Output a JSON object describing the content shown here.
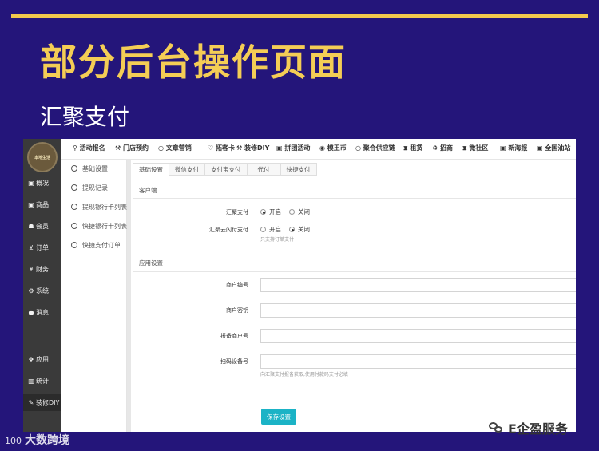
{
  "slide": {
    "title": "部分后台操作页面",
    "subtitle": "汇聚支付"
  },
  "logo_text": "本地生活",
  "left_nav": [
    {
      "icon": "window-icon",
      "glyph": "▣",
      "label": "概况"
    },
    {
      "icon": "box-icon",
      "glyph": "▣",
      "label": "商品"
    },
    {
      "icon": "users-icon",
      "glyph": "👥",
      "label": "会员"
    },
    {
      "icon": "cart-icon",
      "glyph": "🛒",
      "label": "订单"
    },
    {
      "icon": "yen-icon",
      "glyph": "¥",
      "label": "财务"
    },
    {
      "icon": "gears-icon",
      "glyph": "⚙",
      "label": "系统"
    },
    {
      "icon": "chat-icon",
      "glyph": "💬",
      "label": "消息"
    },
    {
      "icon": "apps-icon",
      "glyph": "❖",
      "label": "应用"
    },
    {
      "icon": "chart-icon",
      "glyph": "▥",
      "label": "统计"
    },
    {
      "icon": "brush-icon",
      "glyph": "🖌",
      "label": "装修DIY"
    }
  ],
  "top_nav": [
    {
      "icon": "link-icon",
      "label": "活动报名"
    },
    {
      "icon": "hammer-icon",
      "label": "门店预约"
    },
    {
      "icon": "circle-icon",
      "label": "文章营销"
    },
    {
      "icon": "heart-icon",
      "label": "拓客卡"
    },
    {
      "icon": "hammer-icon",
      "label": "装修DIY"
    },
    {
      "icon": "image-icon",
      "label": "拼团活动"
    },
    {
      "icon": "coin-icon",
      "label": "模王币"
    },
    {
      "icon": "circle-icon",
      "label": "聚合供应链"
    },
    {
      "icon": "hourglass-icon",
      "label": "租赁"
    },
    {
      "icon": "recycle-icon",
      "label": "招商"
    },
    {
      "icon": "hourglass-icon",
      "label": "微社区"
    },
    {
      "icon": "image-icon",
      "label": "新海报"
    },
    {
      "icon": "image-icon",
      "label": "全国油站"
    }
  ],
  "sub_nav": [
    "基础设置",
    "提现记录",
    "提现银行卡列表",
    "快捷银行卡列表",
    "快捷支付订单"
  ],
  "tabs": [
    "基础设置",
    "微信支付",
    "支付宝支付",
    "代付",
    "快捷支付"
  ],
  "section_client": "客户端",
  "section_app": "应用设置",
  "fields": {
    "huiju_pay": {
      "label": "汇聚支付",
      "options": [
        "开启",
        "关闭"
      ],
      "selected": "开启"
    },
    "huiju_flash": {
      "label": "汇聚云闪付支付",
      "options": [
        "开启",
        "关闭"
      ],
      "selected": "关闭",
      "hint": "只支持订单支付"
    },
    "merchant_no": {
      "label": "商户编号",
      "value": ""
    },
    "merchant_key": {
      "label": "商户密钥",
      "value": ""
    },
    "report_merchant_no": {
      "label": "报备商户号",
      "value": ""
    },
    "scan_device_no": {
      "label": "扫码设备号",
      "value": "",
      "hint": "向汇聚支付报备获取,使用付款码支付必填"
    }
  },
  "save_label": "保存设置",
  "watermark_left": "大数跨境",
  "watermark_right": "E企盈服务"
}
